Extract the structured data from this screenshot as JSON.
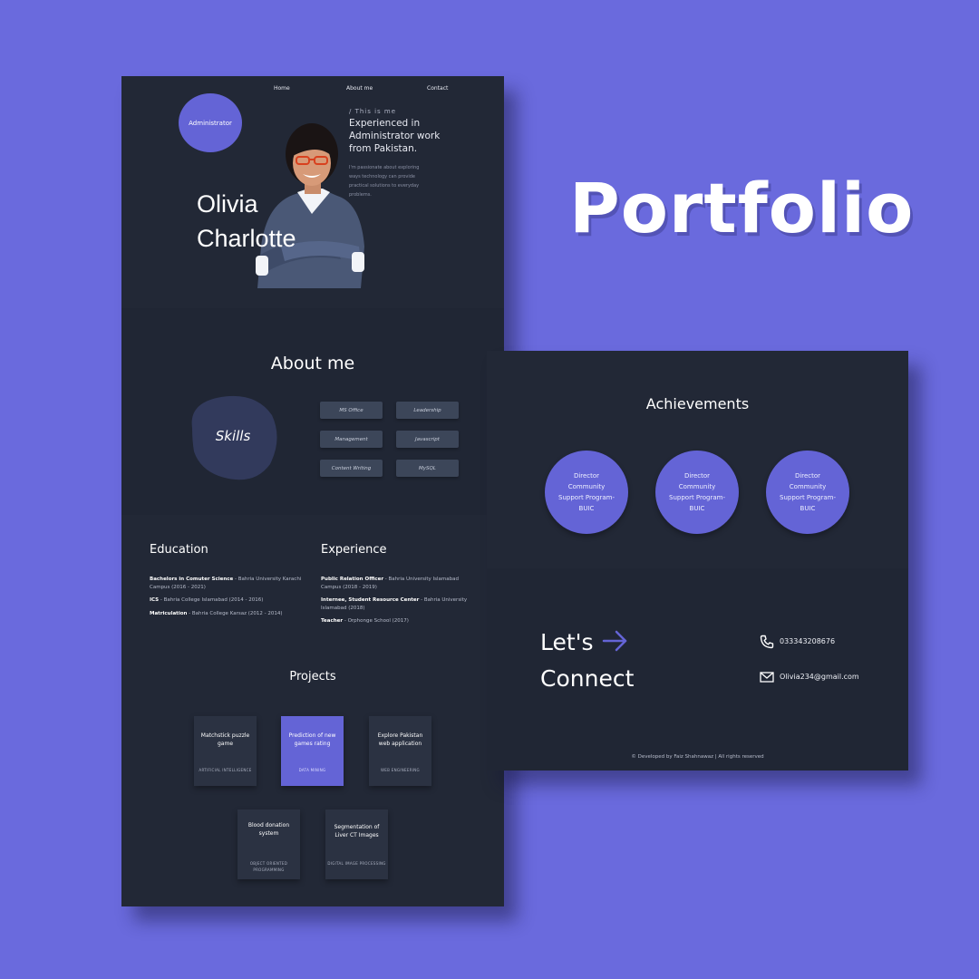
{
  "page_title": "Portfolio",
  "nav": {
    "home": "Home",
    "about": "About me",
    "contact": "Contact"
  },
  "hero": {
    "badge": "Administrator",
    "first_name": "Olivia",
    "last_name": "Charlotte",
    "kicker": "/ This is me",
    "headline": "Experienced in Administrator work from Pakistan.",
    "description": "I'm passionate about exploring ways technology can provide practical solutions to everyday problems."
  },
  "about": {
    "title": "About me",
    "skills_label": "Skills",
    "skills": [
      "MS Office",
      "Leadership",
      "Management",
      "Javascript",
      "Content Writing",
      "MySQL"
    ]
  },
  "education": {
    "title": "Education",
    "items": [
      {
        "degree": "Bachelors in Comuter Science",
        "detail": " - Bahria University Karachi Campus (2016 - 2021)"
      },
      {
        "degree": "ICS",
        "detail": " - Bahria College Islamabad (2014 - 2016)"
      },
      {
        "degree": "Matriculation",
        "detail": " - Bahria College Karsaz (2012 - 2014)"
      }
    ]
  },
  "experience": {
    "title": "Experience",
    "items": [
      {
        "role": "Public Relation Officer",
        "detail": " - Bahria University Islamabad Campus (2018 - 2019)"
      },
      {
        "role": "Internee, Student Resource Center",
        "detail": " - Bahria University Islamabad (2018)"
      },
      {
        "role": "Teacher",
        "detail": " - Orphonge School (2017)"
      }
    ]
  },
  "projects": {
    "title": "Projects",
    "items": [
      {
        "name": "Matchstick puzzle game",
        "tag": "ARTIFICIAL INTELLIGENCE"
      },
      {
        "name": "Prediction of new games rating",
        "tag": "DATA MINING"
      },
      {
        "name": "Explore Pakistan web application",
        "tag": "WEB ENGINEERING"
      },
      {
        "name": "Blood donation system",
        "tag": "OBJECT ORIENTED PROGRAMMING"
      },
      {
        "name": "Segmentation of Liver CT Images",
        "tag": "DIGITAL IMAGE PROCESSING"
      }
    ]
  },
  "achievements": {
    "title": "Achievements",
    "items": [
      "Director Community Support Program-BUIC",
      "Director Community Support Program-BUIC",
      "Director Community Support Program-BUIC"
    ]
  },
  "connect": {
    "line1": "Let's",
    "line2": "Connect",
    "phone": "033343208676",
    "email": "Olivia234@gmail.com"
  },
  "footer": "Developed by  Faiz Shahnawaz  | All rights reserved",
  "colors": {
    "background": "#6a6add",
    "panel": "#222836",
    "accent": "#6464d6"
  }
}
